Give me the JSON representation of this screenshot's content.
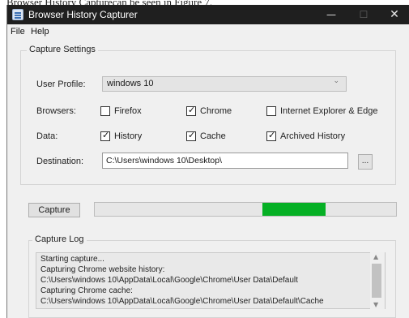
{
  "document": {
    "caption": "Browser History Capturecan be seen in Figure 7."
  },
  "window": {
    "title": "Browser History Capturer",
    "controls": {
      "minimize": "—",
      "maximize": "☐",
      "close": "✕"
    }
  },
  "menu": {
    "file": "File",
    "help": "Help"
  },
  "settings": {
    "legend": "Capture Settings",
    "user_profile": {
      "label": "User Profile:",
      "value": "windows 10",
      "arrow": "⌄"
    },
    "browsers": {
      "label": "Browsers:",
      "options": [
        {
          "label": "Firefox",
          "checked": false,
          "mark": ""
        },
        {
          "label": "Chrome",
          "checked": true,
          "mark": "✓"
        },
        {
          "label": "Internet Explorer & Edge",
          "checked": false,
          "mark": ""
        }
      ]
    },
    "data": {
      "label": "Data:",
      "options": [
        {
          "label": "History",
          "checked": true,
          "mark": "✓"
        },
        {
          "label": "Cache",
          "checked": true,
          "mark": "✓"
        },
        {
          "label": "Archived History",
          "checked": true,
          "mark": "✓"
        }
      ]
    },
    "destination": {
      "label": "Destination:",
      "value": "C:\\Users\\windows 10\\Desktop\\",
      "browse_label": "..."
    }
  },
  "capture": {
    "button_label": "Capture",
    "progress": 0.21
  },
  "log": {
    "legend": "Capture Log",
    "lines": [
      "Starting capture...",
      "Capturing Chrome website history:",
      "C:\\Users\\windows 10\\AppData\\Local\\Google\\Chrome\\User Data\\Default",
      "Capturing Chrome cache:",
      "C:\\Users\\windows 10\\AppData\\Local\\Google\\Chrome\\User Data\\Default\\Cache"
    ],
    "scroll_up": "▲",
    "scroll_down": "▼"
  },
  "colors": {
    "titlebar": "#1f1f1f",
    "progress_fill": "#06b025",
    "window_bg": "#f0f0f0"
  }
}
